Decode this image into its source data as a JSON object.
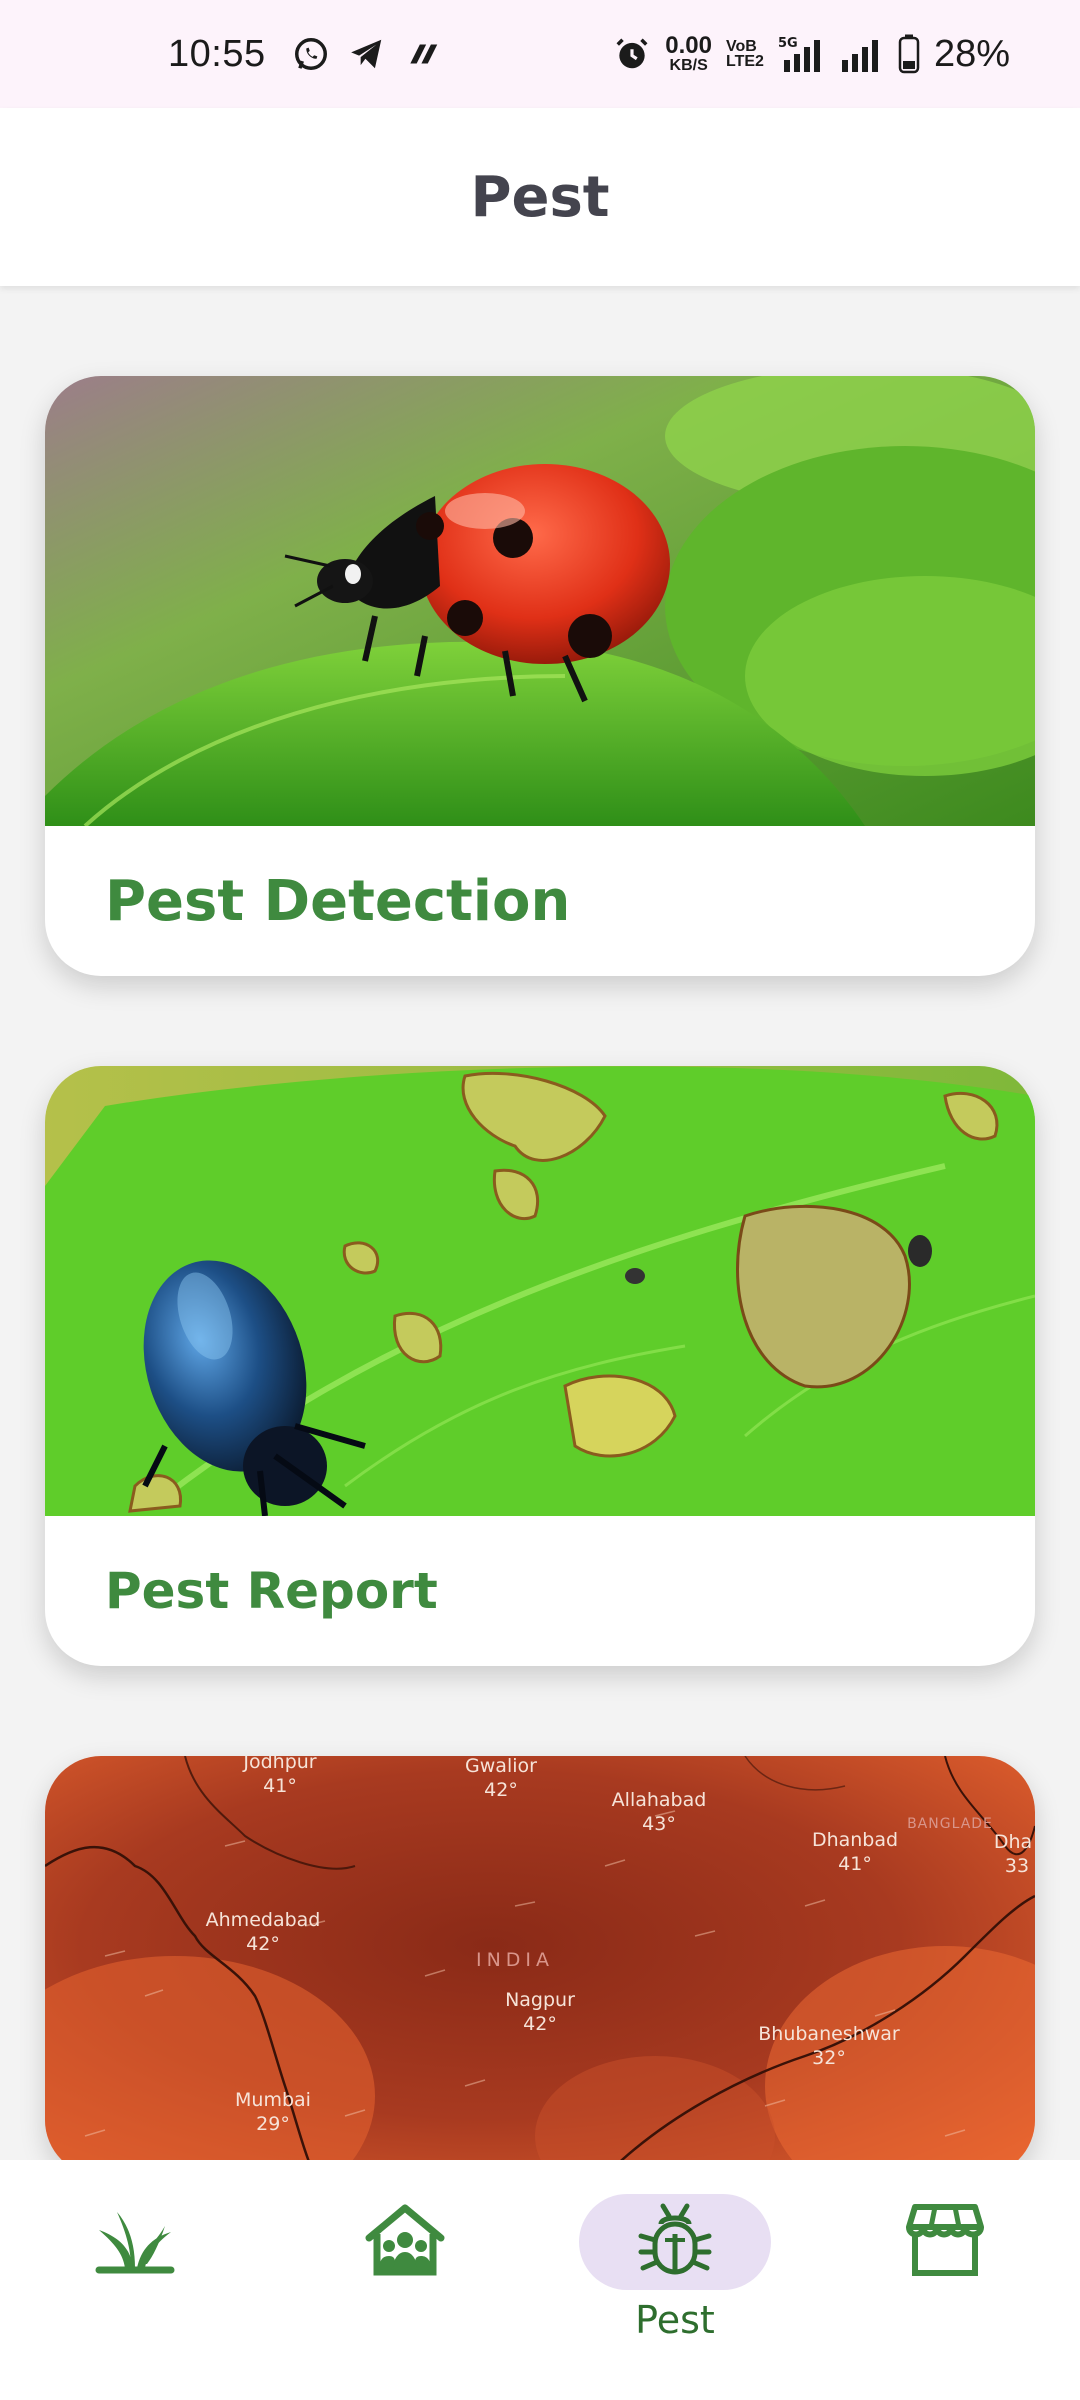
{
  "status_bar": {
    "time": "10:55",
    "net_speed_value": "0.00",
    "net_speed_unit": "KB/S",
    "volte_top": "VoB",
    "volte_bottom": "LTE2",
    "network_type": "5G",
    "battery_percent": "28%"
  },
  "header": {
    "title": "Pest"
  },
  "cards": [
    {
      "title": "Pest Detection",
      "image": "ladybug-on-leaf-photo"
    },
    {
      "title": "Pest Report",
      "image": "beetle-on-eaten-leaf-photo"
    },
    {
      "title": "",
      "image": "india-heat-map",
      "map_labels": [
        {
          "city": "Jodhpur",
          "temp": "41°"
        },
        {
          "city": "Gwalior",
          "temp": "42°"
        },
        {
          "city": "Allahabad",
          "temp": "43°"
        },
        {
          "city": "Dhanbad",
          "temp": "41°"
        },
        {
          "city": "Ahmedabad",
          "temp": "42°"
        },
        {
          "city": "Nagpur",
          "temp": "42°"
        },
        {
          "city": "Bhubaneshwar",
          "temp": "32°"
        },
        {
          "city": "Mumbai",
          "temp": "29°"
        }
      ],
      "country_label": "INDIA",
      "neighbor_label": "BANGLADE",
      "edge_label": "Dha",
      "edge_temp": "33"
    }
  ],
  "bottom_nav": {
    "items": [
      {
        "icon": "plant-sprout-icon",
        "label": ""
      },
      {
        "icon": "community-home-icon",
        "label": ""
      },
      {
        "icon": "bug-icon",
        "label": "Pest",
        "active": true
      },
      {
        "icon": "store-icon",
        "label": ""
      }
    ]
  },
  "colors": {
    "primary_green": "#3f8a3f",
    "active_pill": "#e8dff3",
    "status_bar_bg": "#fdf3fb"
  }
}
